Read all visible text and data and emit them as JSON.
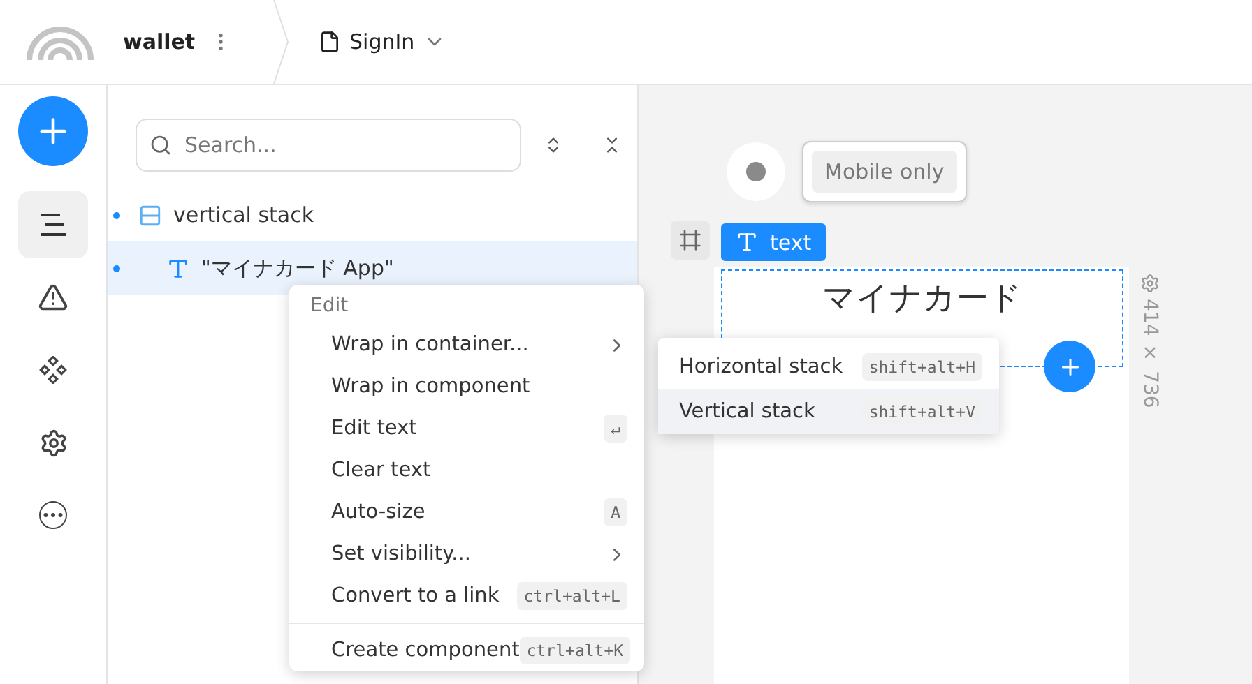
{
  "header": {
    "project": "wallet",
    "page": "SignIn"
  },
  "rail": [
    {
      "kind": "layers",
      "selected": true
    },
    {
      "kind": "warning",
      "selected": false
    },
    {
      "kind": "components",
      "selected": false
    },
    {
      "kind": "settings",
      "selected": false
    },
    {
      "kind": "more",
      "selected": false
    }
  ],
  "layers": {
    "search": {
      "placeholder": "Search..."
    },
    "tree": [
      {
        "kind": "stack",
        "label": "vertical stack",
        "selected": false,
        "children": [
          {
            "kind": "text",
            "label": "\"マイナカード App\"",
            "selected": true
          }
        ]
      }
    ]
  },
  "context_menu": {
    "heading": "Edit",
    "items": [
      {
        "label": "Wrap in container...",
        "submenu": true
      },
      {
        "label": "Wrap in component",
        "submenu": false
      },
      {
        "label": "Edit text",
        "submenu": false,
        "shortcut": "↵"
      },
      {
        "label": "Clear text",
        "submenu": false
      },
      {
        "label": "Auto-size",
        "submenu": false,
        "shortcut": "A"
      },
      {
        "label": "Set visibility...",
        "submenu": true
      },
      {
        "label": "Convert to a link",
        "submenu": false,
        "shortcut": "ctrl+alt+L"
      }
    ],
    "after_divider": [
      {
        "label": "Create component",
        "shortcut": "ctrl+alt+K"
      }
    ]
  },
  "submenu": [
    {
      "label": "Horizontal stack",
      "shortcut": "shift+alt+H",
      "selected": false
    },
    {
      "label": "Vertical stack",
      "shortcut": "shift+alt+V",
      "selected": true
    }
  ],
  "canvas": {
    "breakpoint": "Mobile only",
    "element_tag": "text",
    "text": "マイナカード",
    "size": "414 × 736"
  }
}
